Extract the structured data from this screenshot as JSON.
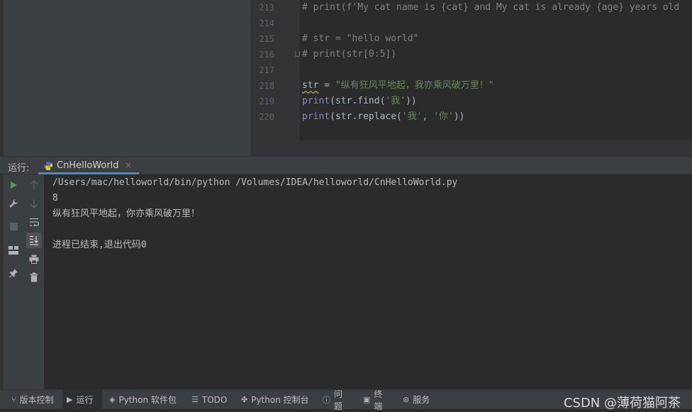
{
  "editor": {
    "lines": [
      {
        "num": "213",
        "segments": [
          {
            "cls": "c-comment",
            "text": "# print(f'My cat name is {cat} and My cat is already {age} years old"
          }
        ]
      },
      {
        "num": "214",
        "segments": []
      },
      {
        "num": "215",
        "segments": [
          {
            "cls": "c-comment",
            "text": "# str = \"hello world\""
          }
        ]
      },
      {
        "num": "216",
        "segments": [
          {
            "cls": "c-comment",
            "text": "# print(str[0:5])"
          }
        ]
      },
      {
        "num": "217",
        "segments": []
      },
      {
        "num": "218",
        "segments": [
          {
            "cls": "c-plain squig",
            "text": "str"
          },
          {
            "cls": "c-plain",
            "text": " = "
          },
          {
            "cls": "c-str",
            "text": "\"纵有狂风平地起，我亦乘风破万里！\""
          }
        ]
      },
      {
        "num": "219",
        "segments": [
          {
            "cls": "c-builtin",
            "text": "print"
          },
          {
            "cls": "c-plain",
            "text": "(str.find("
          },
          {
            "cls": "c-str",
            "text": "'我'"
          },
          {
            "cls": "c-plain",
            "text": "))"
          }
        ]
      },
      {
        "num": "220",
        "segments": [
          {
            "cls": "c-builtin",
            "text": "print"
          },
          {
            "cls": "c-plain",
            "text": "(str.replace("
          },
          {
            "cls": "c-str",
            "text": "'我'"
          },
          {
            "cls": "c-plain",
            "text": ", "
          },
          {
            "cls": "c-str",
            "text": "'你'"
          },
          {
            "cls": "c-plain",
            "text": "))"
          }
        ]
      }
    ]
  },
  "run_panel": {
    "title": "运行:",
    "tab_label": "CnHelloWorld",
    "tab_close": "×",
    "tab_icon": "python-icon"
  },
  "console": {
    "lines": [
      "/Users/mac/helloworld/bin/python /Volumes/IDEA/helloworld/CnHelloWorld.py",
      "8",
      "纵有狂风平地起，你亦乘风破万里！",
      "",
      "进程已结束,退出代码0"
    ]
  },
  "statusbar": {
    "items": [
      {
        "icon": "branch-icon",
        "label": "版本控制"
      },
      {
        "icon": "run-icon",
        "label": "运行"
      },
      {
        "icon": "layers-icon",
        "label": "Python 软件包"
      },
      {
        "icon": "list-icon",
        "label": "TODO"
      },
      {
        "icon": "python-console-icon",
        "label": "Python 控制台"
      },
      {
        "icon": "info-icon",
        "label": "问题"
      },
      {
        "icon": "terminal-icon",
        "label": "终端"
      },
      {
        "icon": "services-icon",
        "label": "服务"
      }
    ],
    "watermark": "CSDN @薄荷猫阿茶"
  },
  "colors": {
    "accent": "#4a88c7",
    "run_green": "#499c54",
    "comment": "#808080",
    "string": "#6a8759",
    "builtin": "#8888c6"
  }
}
